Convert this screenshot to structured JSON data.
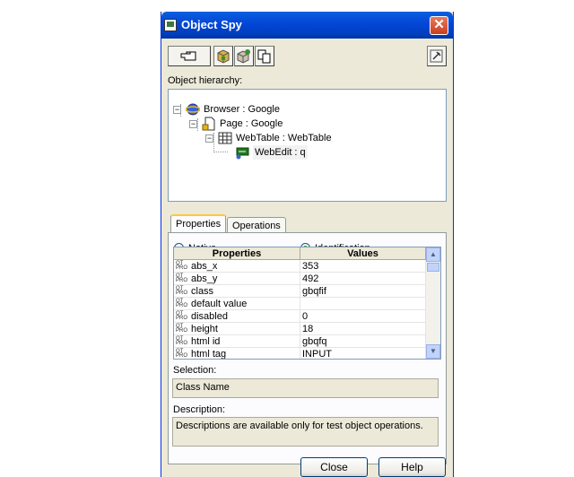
{
  "window": {
    "title": "Object Spy"
  },
  "hierarchy": {
    "label": "Object hierarchy:",
    "nodes": [
      {
        "text": "Browser : Google",
        "expander": "−"
      },
      {
        "text": "Page : Google",
        "expander": "−"
      },
      {
        "text": "WebTable : WebTable",
        "expander": "−"
      },
      {
        "text": "WebEdit : q"
      }
    ]
  },
  "tabs": {
    "properties": "Properties",
    "operations": "Operations"
  },
  "radios": {
    "native": "Native",
    "identification": "Identification",
    "selected": "identification"
  },
  "grid": {
    "headers": {
      "properties": "Properties",
      "values": "Values"
    },
    "rows": [
      {
        "name": "abs_x",
        "value": "353"
      },
      {
        "name": "abs_y",
        "value": "492"
      },
      {
        "name": "class",
        "value": "gbqfif"
      },
      {
        "name": "default value",
        "value": ""
      },
      {
        "name": "disabled",
        "value": "0"
      },
      {
        "name": "height",
        "value": "18"
      },
      {
        "name": "html id",
        "value": "gbqfq"
      },
      {
        "name": "html tag",
        "value": "INPUT"
      }
    ]
  },
  "selection": {
    "label": "Selection:",
    "value": "Class Name"
  },
  "description": {
    "label": "Description:",
    "value": "Descriptions are available only for test object operations."
  },
  "buttons": {
    "close": "Close",
    "help": "Help"
  }
}
